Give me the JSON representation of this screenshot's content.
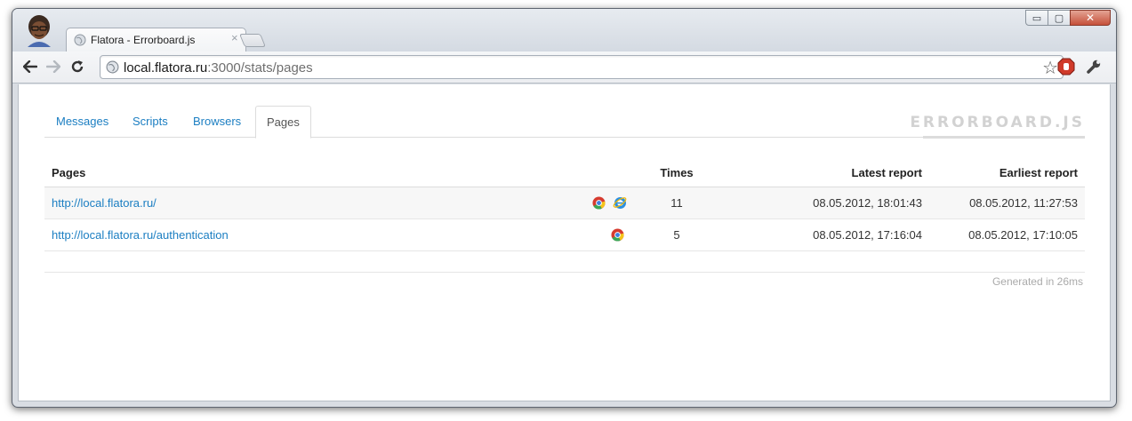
{
  "browser": {
    "tab_title": "Flatora - Errorboard.js",
    "close_glyph": "×",
    "url_host": "local.flatora.ru",
    "url_path": ":3000/stats/pages",
    "window_controls": {
      "minimize": "▭",
      "maximize": "▢",
      "close": "✕"
    }
  },
  "app": {
    "brand": "ERRORBOARD.JS",
    "tabs": [
      {
        "label": "Messages",
        "active": false
      },
      {
        "label": "Scripts",
        "active": false
      },
      {
        "label": "Browsers",
        "active": false
      },
      {
        "label": "Pages",
        "active": true
      }
    ],
    "table": {
      "headers": {
        "page": "Pages",
        "times": "Times",
        "latest": "Latest report",
        "earliest": "Earliest report"
      },
      "rows": [
        {
          "page": "http://local.flatora.ru/",
          "browsers": [
            "chrome-icon",
            "ie-icon"
          ],
          "times": "11",
          "latest": "08.05.2012, 18:01:43",
          "earliest": "08.05.2012, 11:27:53"
        },
        {
          "page": "http://local.flatora.ru/authentication",
          "browsers": [
            "chrome-icon"
          ],
          "times": "5",
          "latest": "08.05.2012, 17:16:04",
          "earliest": "08.05.2012, 17:10:05"
        }
      ]
    },
    "generated": "Generated in 26ms"
  },
  "colors": {
    "link": "#1b7ec2",
    "brand": "#d2d2d2",
    "close_button": "#c5503a"
  }
}
